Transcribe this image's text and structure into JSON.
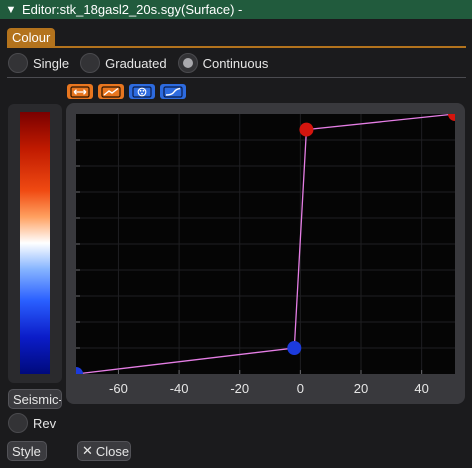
{
  "window": {
    "title": "Editor:stk_18gasl2_20s.sgy(Surface) -"
  },
  "tabs": [
    {
      "label": "Colour"
    }
  ],
  "mode": {
    "options": [
      {
        "label": "Single",
        "selected": false
      },
      {
        "label": "Graduated",
        "selected": false
      },
      {
        "label": "Continuous",
        "selected": true
      }
    ]
  },
  "toolbar": {
    "icons": [
      "range-arrows-icon",
      "line-chart-icon",
      "palette-icon",
      "curve-chart-icon"
    ],
    "colors": {
      "orange": "#e8761f",
      "blue": "#2d6bdf"
    }
  },
  "colorbar": {
    "name": "Seismic-",
    "reverse_label": "Rev"
  },
  "buttons": {
    "style": "Style",
    "close": "Close"
  },
  "chart_data": {
    "type": "line",
    "x_ticks": [
      "-60",
      "-40",
      "-20",
      "0",
      "20",
      "40"
    ],
    "xlim": [
      -74,
      51
    ],
    "ylim": [
      0,
      1
    ],
    "grid": true,
    "series": [
      {
        "x": [
          -74,
          -2,
          2,
          51
        ],
        "y": [
          0,
          0.1,
          0.94,
          1
        ],
        "color": "#e57ee5"
      }
    ],
    "control_points": [
      {
        "x": -2,
        "y": 0.1,
        "color": "#1c3bdc"
      },
      {
        "x": 2,
        "y": 0.94,
        "color": "#d4150e"
      }
    ],
    "end_points": [
      {
        "x": -74,
        "y": 0,
        "color": "#1c3bdc"
      },
      {
        "x": 51,
        "y": 1,
        "color": "#d4150e"
      }
    ]
  }
}
